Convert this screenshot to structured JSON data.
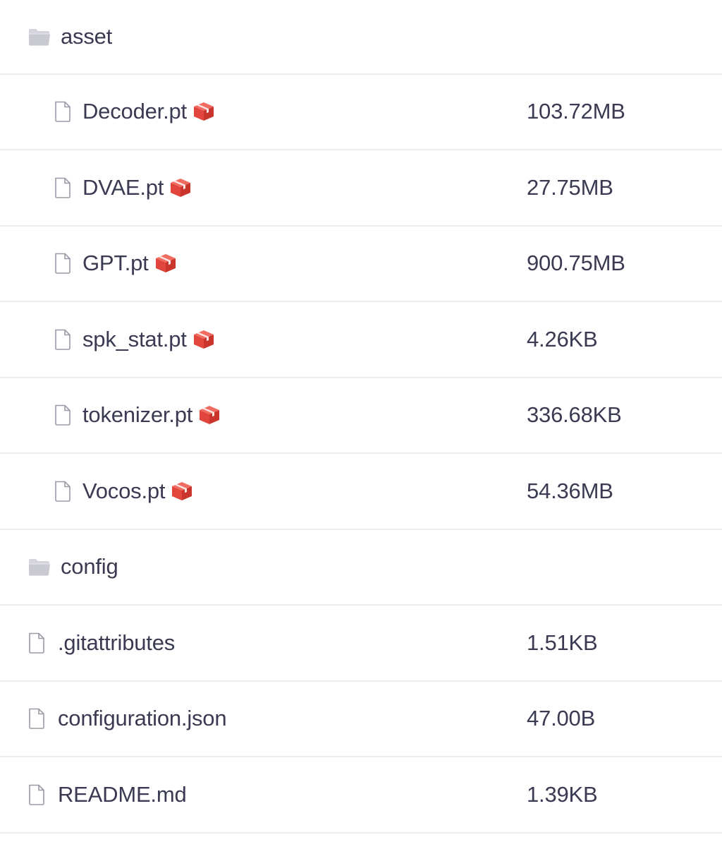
{
  "rows": [
    {
      "type": "folder",
      "name": "asset",
      "icon": "folder-icon",
      "size": ""
    },
    {
      "type": "file",
      "name": "Decoder.pt",
      "icon": "file-icon",
      "lfs": true,
      "size": "103.72MB"
    },
    {
      "type": "file",
      "name": "DVAE.pt",
      "icon": "file-icon",
      "lfs": true,
      "size": "27.75MB"
    },
    {
      "type": "file",
      "name": "GPT.pt",
      "icon": "file-icon",
      "lfs": true,
      "size": "900.75MB"
    },
    {
      "type": "file",
      "name": "spk_stat.pt",
      "icon": "file-icon",
      "lfs": true,
      "size": "4.26KB"
    },
    {
      "type": "file",
      "name": "tokenizer.pt",
      "icon": "file-icon",
      "lfs": true,
      "size": "336.68KB"
    },
    {
      "type": "file",
      "name": "Vocos.pt",
      "icon": "file-icon",
      "lfs": true,
      "size": "54.36MB"
    },
    {
      "type": "folder",
      "name": "config",
      "icon": "folder-icon",
      "size": ""
    },
    {
      "type": "file",
      "name": ".gitattributes",
      "icon": "file-icon",
      "lfs": false,
      "size": "1.51KB"
    },
    {
      "type": "file",
      "name": "configuration.json",
      "icon": "file-icon",
      "lfs": false,
      "size": "47.00B"
    },
    {
      "type": "file",
      "name": "README.md",
      "icon": "file-icon",
      "lfs": false,
      "size": "1.39KB"
    }
  ],
  "colors": {
    "text": "#3a3a52",
    "divider": "#ececf0",
    "folder_icon": "#c9c9d2",
    "file_icon": "#9a9aa8",
    "lfs_red": "#e2453c"
  }
}
